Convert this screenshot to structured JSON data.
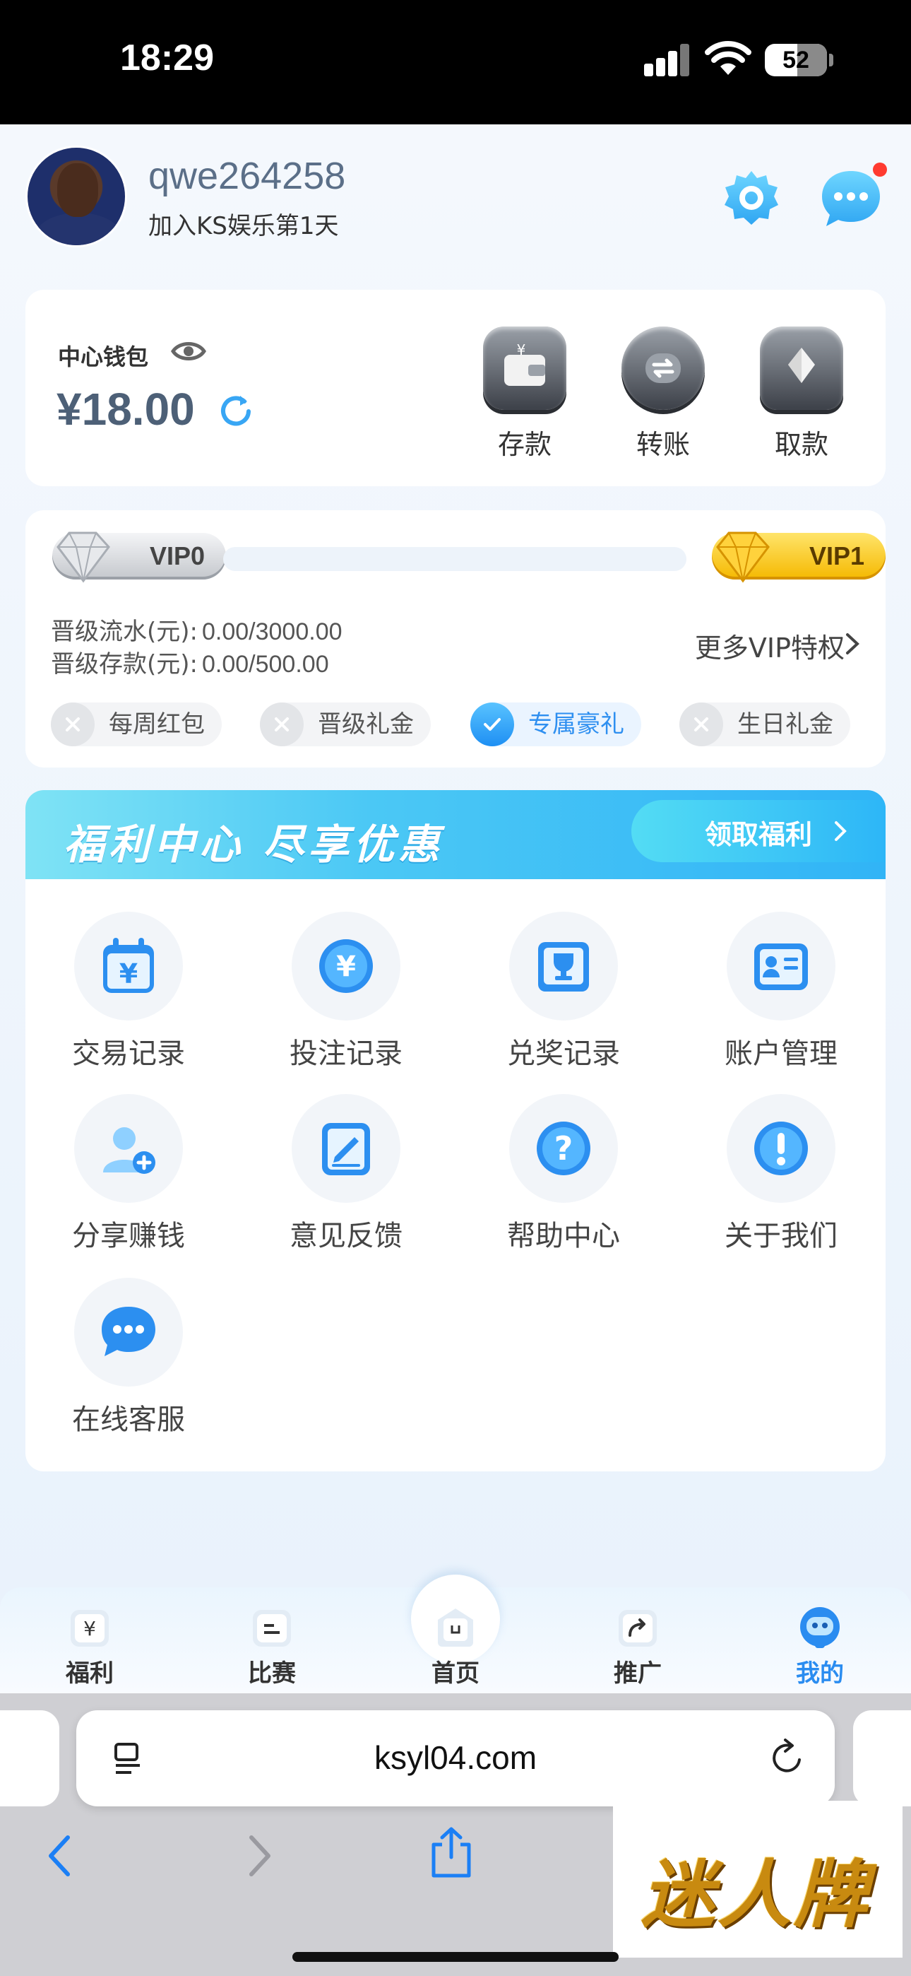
{
  "status_bar": {
    "time": "18:29",
    "battery": "52",
    "battery_level": 0.52
  },
  "header": {
    "username": "qwe264258",
    "joined": "加入KS娱乐第1天",
    "icons": [
      "settings-gear-icon",
      "message-bubble-icon"
    ],
    "has_unread": true
  },
  "wallet": {
    "label": "中心钱包",
    "balance": "¥18.00",
    "actions": [
      {
        "label": "存款",
        "icon": "deposit-wallet-icon"
      },
      {
        "label": "转账",
        "icon": "transfer-icon"
      },
      {
        "label": "取款",
        "icon": "withdraw-diamond-icon"
      }
    ]
  },
  "vip": {
    "current": "VIP0",
    "next": "VIP1",
    "progress": 0.0,
    "turnover_label": "晋级流水(元):",
    "turnover_value": "0.00/3000.00",
    "deposit_label": "晋级存款(元):",
    "deposit_value": "0.00/500.00",
    "more_label": "更多VIP特权",
    "perks": [
      {
        "label": "每周红包",
        "active": false
      },
      {
        "label": "晋级礼金",
        "active": false
      },
      {
        "label": "专属豪礼",
        "active": true
      },
      {
        "label": "生日礼金",
        "active": false
      }
    ]
  },
  "welfare": {
    "title": "福利中心 尽享优惠",
    "claim_label": "领取福利",
    "items": [
      {
        "label": "交易记录",
        "icon": "calendar-yen-icon"
      },
      {
        "label": "投注记录",
        "icon": "yen-coin-icon"
      },
      {
        "label": "兑奖记录",
        "icon": "trophy-icon"
      },
      {
        "label": "账户管理",
        "icon": "id-card-icon"
      },
      {
        "label": "分享赚钱",
        "icon": "add-user-icon"
      },
      {
        "label": "意见反馈",
        "icon": "edit-note-icon"
      },
      {
        "label": "帮助中心",
        "icon": "help-question-icon"
      },
      {
        "label": "关于我们",
        "icon": "info-exclamation-icon"
      },
      {
        "label": "在线客服",
        "icon": "chat-bubble-icon"
      }
    ]
  },
  "tabbar": {
    "tabs": [
      {
        "label": "福利",
        "icon": "yen-box-icon",
        "active": false
      },
      {
        "label": "比赛",
        "icon": "match-list-icon",
        "active": false
      },
      {
        "label": "首页",
        "icon": "home-icon",
        "active": false
      },
      {
        "label": "推广",
        "icon": "share-arrow-icon",
        "active": false
      },
      {
        "label": "我的",
        "icon": "robot-face-icon",
        "active": true
      }
    ]
  },
  "browser": {
    "url": "ksyl04.com"
  },
  "watermark": {
    "text": "迷人牌"
  },
  "colors": {
    "accent": "#2a8cf0",
    "banner": "#31b4f6",
    "vip_gold": "#f5b800"
  }
}
